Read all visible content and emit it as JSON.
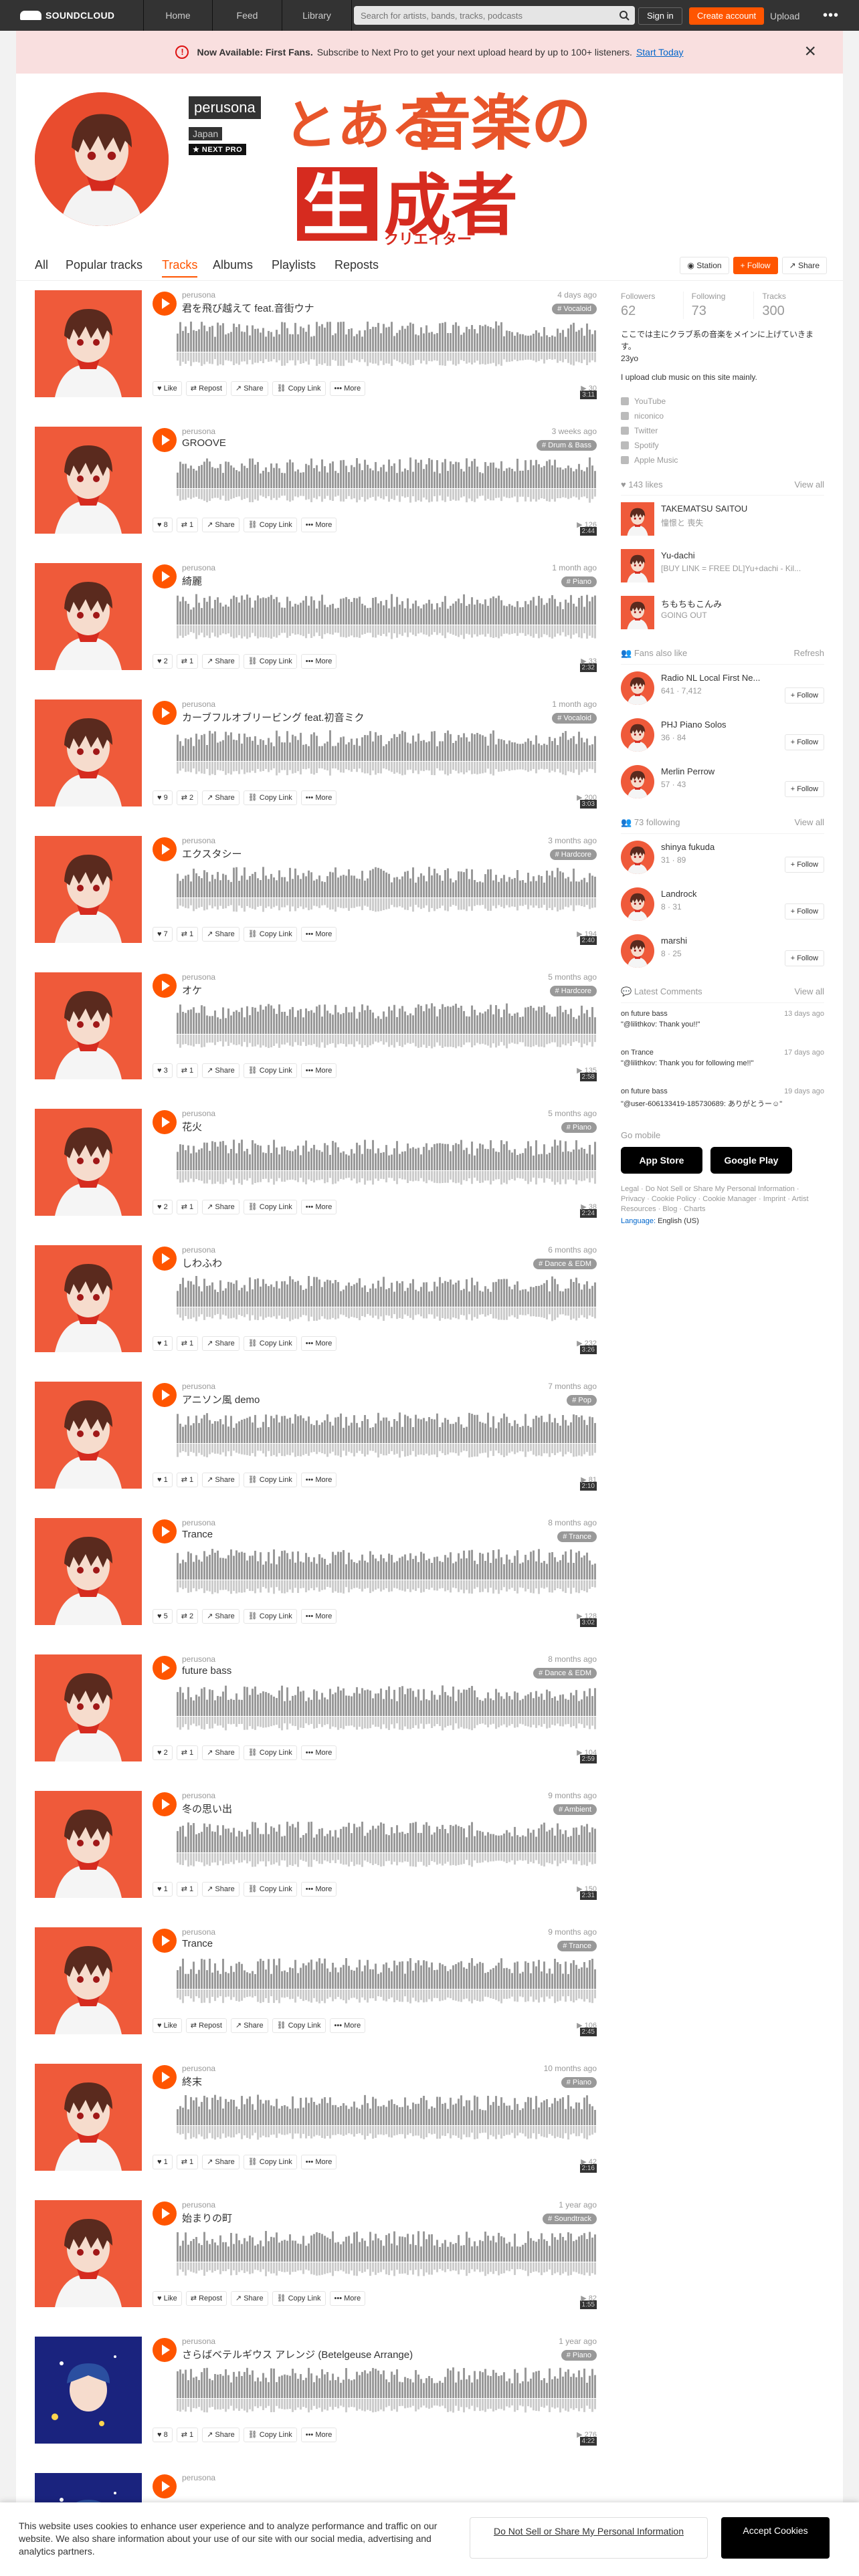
{
  "header": {
    "logo_text": "SOUNDCLOUD",
    "nav": [
      "Home",
      "Feed",
      "Library"
    ],
    "search_placeholder": "Search for artists, bands, tracks, podcasts",
    "sign_in": "Sign in",
    "create_account": "Create account",
    "upload": "Upload",
    "more": "•••"
  },
  "banner": {
    "bold": "Now Available: First Fans.",
    "text": "Subscribe to Next Pro to get your next upload heard by up to 100+ listeners.",
    "cta": "Start Today"
  },
  "profile": {
    "name": "perusona",
    "country": "Japan",
    "badge": "NEXT PRO",
    "art_line1_kana": "とある",
    "art_line1_kanji": "音楽の",
    "art_line2_box": "生",
    "art_line2": "成者",
    "art_subtitle": "クリエイター"
  },
  "tabs": [
    "All",
    "Popular tracks",
    "Tracks",
    "Albums",
    "Playlists",
    "Reposts"
  ],
  "tab_actions": {
    "station": "Station",
    "follow": "Follow",
    "share": "Share"
  },
  "accent_color": "#ff5500",
  "track_actions": {
    "like": "Like",
    "repost": "Repost",
    "share": "Share",
    "copy_link": "Copy Link",
    "more": "More"
  },
  "tracks": [
    {
      "user": "perusona",
      "title": "君を飛び越えて feat.音街ウナ",
      "date": "4 days ago",
      "tag": "# Vocaloid",
      "duration": "3:11",
      "plays": "30",
      "likes": "",
      "reposts": ""
    },
    {
      "user": "perusona",
      "title": "GROOVE",
      "date": "3 weeks ago",
      "tag": "# Drum & Bass",
      "duration": "2:44",
      "plays": "126",
      "likes": "8",
      "reposts": "1"
    },
    {
      "user": "perusona",
      "title": "綺麗",
      "date": "1 month ago",
      "tag": "# Piano",
      "duration": "2:32",
      "plays": "33",
      "likes": "2",
      "reposts": "1"
    },
    {
      "user": "perusona",
      "title": "カーブフルオブリービング feat.初音ミク",
      "date": "1 month ago",
      "tag": "# Vocaloid",
      "duration": "3:03",
      "plays": "200",
      "likes": "9",
      "reposts": "2"
    },
    {
      "user": "perusona",
      "title": "エクスタシー",
      "date": "3 months ago",
      "tag": "# Hardcore",
      "duration": "2:40",
      "plays": "194",
      "likes": "7",
      "reposts": "1"
    },
    {
      "user": "perusona",
      "title": "オケ",
      "date": "5 months ago",
      "tag": "# Hardcore",
      "duration": "2:58",
      "plays": "135",
      "likes": "3",
      "reposts": "1"
    },
    {
      "user": "perusona",
      "title": "花火",
      "date": "5 months ago",
      "tag": "# Piano",
      "duration": "2:24",
      "plays": "38",
      "likes": "2",
      "reposts": "1"
    },
    {
      "user": "perusona",
      "title": "しわふわ",
      "date": "6 months ago",
      "tag": "# Dance & EDM",
      "duration": "3:26",
      "plays": "232",
      "likes": "1",
      "reposts": "1"
    },
    {
      "user": "perusona",
      "title": "アニソン風 demo",
      "date": "7 months ago",
      "tag": "# Pop",
      "duration": "2:10",
      "plays": "81",
      "likes": "1",
      "reposts": "1"
    },
    {
      "user": "perusona",
      "title": "Trance",
      "date": "8 months ago",
      "tag": "# Trance",
      "duration": "3:02",
      "plays": "128",
      "likes": "5",
      "reposts": "2"
    },
    {
      "user": "perusona",
      "title": "future bass",
      "date": "8 months ago",
      "tag": "# Dance & EDM",
      "duration": "2:59",
      "plays": "104",
      "likes": "2",
      "reposts": "1"
    },
    {
      "user": "perusona",
      "title": "冬の思い出",
      "date": "9 months ago",
      "tag": "# Ambient",
      "duration": "2:31",
      "plays": "150",
      "likes": "1",
      "reposts": "1"
    },
    {
      "user": "perusona",
      "title": "Trance",
      "date": "9 months ago",
      "tag": "# Trance",
      "duration": "2:45",
      "plays": "106",
      "likes": "",
      "reposts": ""
    },
    {
      "user": "perusona",
      "title": "終末",
      "date": "10 months ago",
      "tag": "# Piano",
      "duration": "2:16",
      "plays": "42",
      "likes": "1",
      "reposts": "1"
    },
    {
      "user": "perusona",
      "title": "始まりの町",
      "date": "1 year ago",
      "tag": "# Soundtrack",
      "duration": "1:55",
      "plays": "82",
      "likes": "",
      "reposts": ""
    },
    {
      "user": "perusona",
      "title": "さらばベテルギウス アレンジ (Betelgeuse Arrange)",
      "date": "1 year ago",
      "tag": "# Piano",
      "duration": "4:22",
      "plays": "276",
      "likes": "8",
      "reposts": "1"
    },
    {
      "user": "perusona",
      "title": "",
      "date": "",
      "tag": "",
      "duration": "",
      "plays": "",
      "likes": "",
      "reposts": ""
    }
  ],
  "sidebar": {
    "stats": [
      {
        "label": "Followers",
        "value": "62"
      },
      {
        "label": "Following",
        "value": "73"
      },
      {
        "label": "Tracks",
        "value": "300"
      }
    ],
    "bio": [
      "ここでは主にクラブ系の音楽をメインに上げていきます。",
      "23yo",
      "",
      "I upload club music on this site mainly."
    ],
    "links": [
      "YouTube",
      "niconico",
      "Twitter",
      "Spotify",
      "Apple Music"
    ],
    "likes_header": "143 likes",
    "view_all": "View all",
    "likes": [
      {
        "name": "TAKEMATSU SAITOU",
        "sub": "憧憬と 喪失"
      },
      {
        "name": "Yu-dachi",
        "sub": "[BUY LINK = FREE DL]Yu+dachi - Kil..."
      },
      {
        "name": "ちもちもこんみ",
        "sub": "GOING OUT"
      }
    ],
    "fans_header": "Fans also like",
    "refresh": "Refresh",
    "fans": [
      {
        "name": "Radio NL Local First Ne...",
        "sub": "641 · 7,412"
      },
      {
        "name": "PHJ Piano Solos",
        "sub": "36 · 84"
      },
      {
        "name": "Merlin Perrow",
        "sub": "57 · 43"
      }
    ],
    "following_header": "73 following",
    "following": [
      {
        "name": "shinya fukuda",
        "sub": "31 · 89"
      },
      {
        "name": "Landrock",
        "sub": "8 · 31"
      },
      {
        "name": "marshi",
        "sub": "8 · 25"
      }
    ],
    "follow_label": "Follow",
    "comments_header": "Latest Comments",
    "comments": [
      {
        "on": "on future bass",
        "time": "13 days ago",
        "body": "\"@lilithkov: Thank you!!\""
      },
      {
        "on": "on Trance",
        "time": "17 days ago",
        "body": "\"@lilithkov: Thank you for following me!!\""
      },
      {
        "on": "on future bass",
        "time": "19 days ago",
        "body": "\"@user-606133419-185730689: ありがとうー☺\""
      }
    ],
    "mobile_label": "Go mobile",
    "app_store": "App Store",
    "google_play": "Google Play",
    "footer_links": "Legal · Do Not Sell or Share My Personal Information · Privacy · Cookie Policy · Cookie Manager · Imprint · Artist Resources · Blog · Charts",
    "language_label": "Language:",
    "language_value": "English (US)"
  },
  "cookie": {
    "message": "This website uses cookies to enhance user experience and to analyze performance and traffic on our website. We also share information about your use of our site with our social media, advertising and analytics partners.",
    "do_not_sell": "Do Not Sell or Share My Personal Information",
    "accept": "Accept Cookies"
  }
}
